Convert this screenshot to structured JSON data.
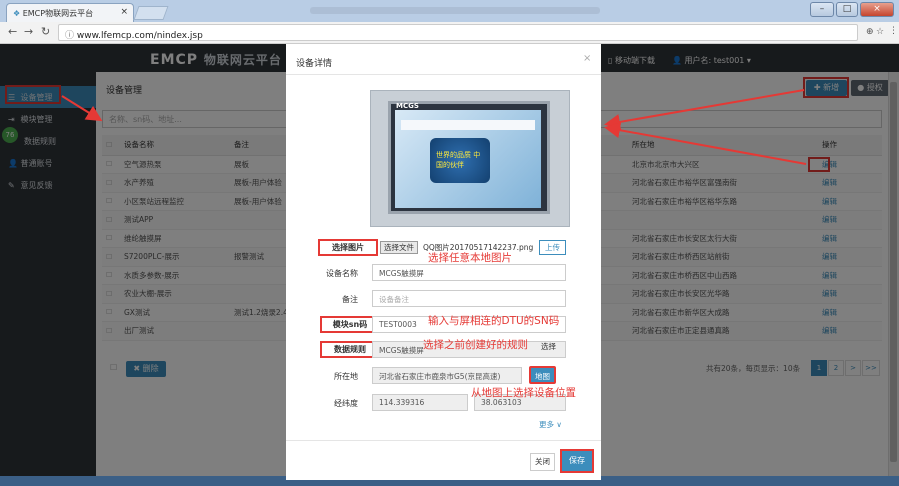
{
  "browser": {
    "tab_title": "EMCP物联网云平台",
    "tab_close": "×",
    "url": "www.lfemcp.com/nindex.jsp",
    "window_buttons": [
      "–",
      "□",
      "×"
    ]
  },
  "navbar": {
    "logo_main": "EMCP",
    "logo_sub": "物联网云平台",
    "mobile_download": "移动端下载",
    "user": "用户名: test001"
  },
  "sidebar": {
    "badge": "76",
    "items": [
      {
        "label": "设备管理",
        "icon": "list-icon"
      },
      {
        "label": "模块管理",
        "icon": "module-icon"
      },
      {
        "label": "数据规则",
        "icon": "rule-icon"
      },
      {
        "label": "普通账号",
        "icon": "user-icon"
      },
      {
        "label": "意见反馈",
        "icon": "edit-icon"
      }
    ]
  },
  "main": {
    "title": "设备管理",
    "search_placeholder": "名称、sn码、地址...",
    "add_button": "✚ 新增",
    "auth_button": "● 授权",
    "columns": [
      "设备名称",
      "备注",
      "所在地",
      "操作"
    ],
    "rows": [
      {
        "name": "空气源热泵",
        "note": "展板",
        "location": "北京市北京市大兴区",
        "action": "编辑"
      },
      {
        "name": "水产养殖",
        "note": "展板-用户体验",
        "location": "河北省石家庄市裕华区富强南街",
        "action": "编辑"
      },
      {
        "name": "小区泵站远程监控",
        "note": "展板-用户体验",
        "location": "河北省石家庄市裕华区裕华东路",
        "action": "编辑"
      },
      {
        "name": "测试APP",
        "note": "",
        "location": "",
        "action": "编辑"
      },
      {
        "name": "维纶触摸屏",
        "note": "",
        "location": "河北省石家庄市长安区太行大街",
        "action": "编辑"
      },
      {
        "name": "S7200PLC-展示",
        "note": "报警测试",
        "location": "河北省石家庄市桥西区站前街",
        "action": "编辑"
      },
      {
        "name": "水质多参数-展示",
        "note": "",
        "location": "河北省石家庄市桥西区中山西路",
        "action": "编辑"
      },
      {
        "name": "农业大棚-展示",
        "note": "",
        "location": "河北省石家庄市长安区光华路",
        "action": "编辑"
      },
      {
        "name": "GX测试",
        "note": "测试1.2烧录2.4",
        "location": "河北省石家庄市新华区大成路",
        "action": "编辑"
      },
      {
        "name": "出厂测试",
        "note": "",
        "location": "河北省石家庄市正定县通真路",
        "action": "编辑"
      }
    ],
    "delete_button": "✖ 删除",
    "pager_info": "共有20条，每页显示：10条",
    "pages": [
      "1",
      "2",
      ">",
      ">>"
    ]
  },
  "modal": {
    "title": "设备详情",
    "close": "×",
    "device_brand": "MCGS",
    "device_screen_text": "世界的品质 中国的伙伴",
    "labels": {
      "image": "选择图片",
      "name": "设备名称",
      "note": "备注",
      "sn": "模块sn码",
      "rule": "数据规则",
      "location": "所在地",
      "lnglat": "经纬度"
    },
    "file_choose": "选择文件",
    "file_name": "QQ图片20170517142237.png",
    "upload": "上传",
    "name_value": "MCGS触摸屏",
    "note_placeholder": "设备备注",
    "sn_value": "TEST0003",
    "rule_value": "MCGS触摸屏",
    "choose_rule": "选择",
    "location_value": "河北省石家庄市鹿泉市G5(京昆高速)",
    "map_button": "地图",
    "longitude": "114.339316",
    "latitude": "38.063103",
    "more": "更多 ∨",
    "cancel": "关闭",
    "save": "保存"
  },
  "annotations": {
    "image": "选择任意本地图片",
    "sn": "输入与屏相连的DTU的SN码",
    "rule": "选择之前创建好的规则",
    "map": "从地图上选择设备位置"
  },
  "colors": {
    "accent": "#3c8dbc",
    "annotation": "#e53935",
    "navbar": "#2f3439"
  }
}
